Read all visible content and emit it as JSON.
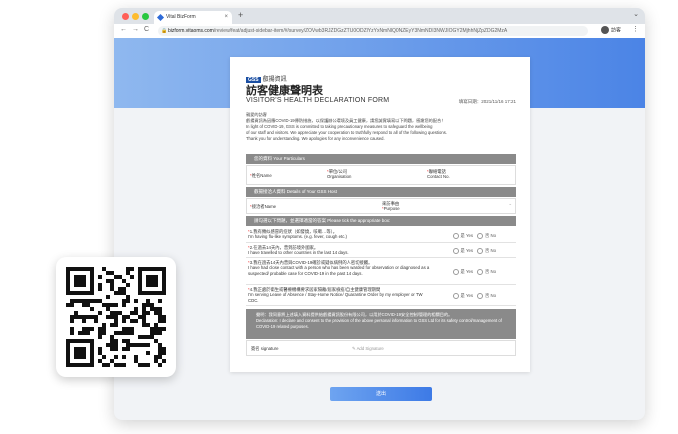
{
  "browser": {
    "tab_title": "Vital BizForm",
    "tab_close": "×",
    "new_tab": "+",
    "url_host": "bizform.vitaoms.com",
    "url_path": "/review/feat/adjust-sidebar-item/#/survey/ZOVwb3RJZDGzZTU0ODZlYzYxNmNlQ0NZEyY3NmNDI3NWJIOGY2MjhhNjZpZDG2MzA",
    "profile_label": "訪客",
    "back_icon": "arrow-left-icon",
    "forward_icon": "arrow-right-icon",
    "reload_icon": "reload-icon"
  },
  "form": {
    "logo_text": "GSS",
    "logo_company": "叡揚資訊",
    "title_zh": "訪客健康聲明表",
    "title_en": "VISITOR'S HEALTH DECLARATION FORM",
    "fill_date": "填寫日期：2021/11/16 17:21",
    "intro_lines": [
      "親愛的訪客",
      "叡揚資訊為因應COVID-19傳防措施，以保護辦公環境及員工健康，請您誠實填寫以下問題，感謝您的配合！",
      "In light of COVID-19, GSS is committed to taking precautionary measures to safeguard the wellbeing",
      "of our staff and visitors. We appreciate your cooperation to truthfully respond to all of the following questions.",
      "Thank you for understanding. We apologies for any inconvenience caused."
    ],
    "sections": {
      "particulars": "您的資料 Your Particulars",
      "host": "叡揚接洽人資料 Details of Your GSS Host",
      "tick": "請勾選以下問題，並選擇適當的答案 Please tick the appropriate box:"
    },
    "fields": {
      "name": "姓名Name",
      "org_zh": "單位/公司",
      "org_en": "Organisation",
      "contact_zh": "聯絡電話",
      "contact_en": "Contact No.",
      "host_name": "接洽者Name",
      "purpose_zh": "來訪事由",
      "purpose_en": "Purpose"
    },
    "questions": [
      {
        "zh": "1.我有類似感冒的症狀（如發燒，咳嗽…等）。",
        "en": "I'm having flu-like symptoms. (e.g. fever, cough etc.)"
      },
      {
        "zh": "2.在過去14天內，曾到訪境外國家。",
        "en": "I have travelled to other countries in the last 14 days."
      },
      {
        "zh": "3.我在過去14天內曾與COVID-19確診或疑似病例的人密切接觸。",
        "en": "I have had close contact with a person who has been warded for observation or diagnosed as a suspected/ probable case for COVID-19 in the past 14 days."
      },
      {
        "zh": "4.我正處於衛生或醫療機構要求居家隔離/居家檢疫/自主健康管理期間",
        "en": "I'm serving Leave of Absence / Stay-Home Notice/ Quarantine Order by my employer or TW CDC."
      }
    ],
    "yes_label": "是 Yes",
    "no_label": "否 No",
    "declaration_zh": "聲明：我同意將上述填入資料提供給叡揚資訊股份有限公司，以用於COVID-19安全控制/管理的相關目的。",
    "declaration_en": "Declaration: I declare and consent to the provision of the above personal information to GSS Ltd for its safety control/management of COVID-19 related purposes.",
    "signature_label": "簽名 signature",
    "add_signature": "Add Signature",
    "submit": "送出"
  },
  "colors": {
    "banner_start": "#8fb8ef",
    "banner_end": "#4b84e6",
    "section_bg": "#8a8a8a",
    "logo_blue": "#1b4fa3",
    "required": "#e33333"
  }
}
